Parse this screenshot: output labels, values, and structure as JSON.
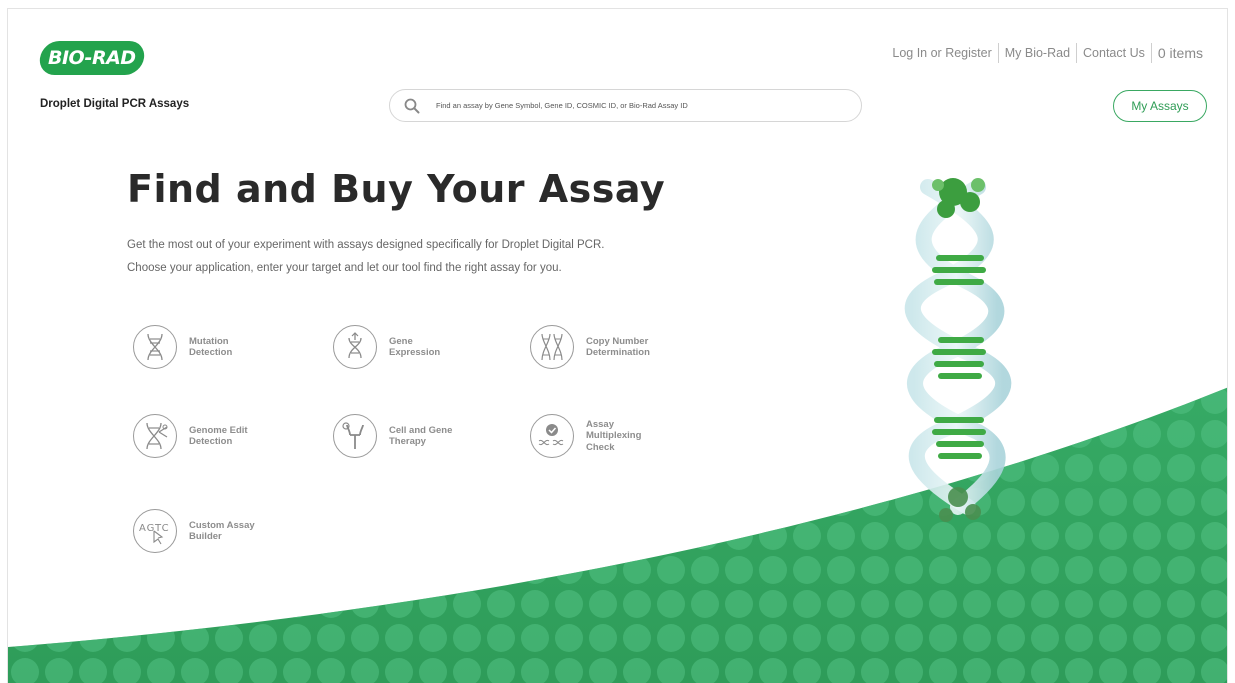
{
  "brand": {
    "logo_text": "BIO-RAD",
    "accent": "#23a34d"
  },
  "top_nav": {
    "login": "Log In or Register",
    "my_biorad": "My Bio-Rad",
    "contact": "Contact Us",
    "cart": "0 items"
  },
  "header": {
    "subtitle": "Droplet Digital PCR Assays",
    "search_placeholder": "Find an assay by Gene Symbol, Gene ID, COSMIC ID, or Bio-Rad Assay ID",
    "my_assays": "My Assays"
  },
  "hero": {
    "title": "Find and Buy Your Assay",
    "line1": "Get the most out of your experiment with assays designed specifically for Droplet Digital PCR.",
    "line2": "Choose your application, enter your target and let our tool find the right assay for you."
  },
  "applications": [
    {
      "label": "Mutation\nDetection",
      "icon": "dna-mutation-icon"
    },
    {
      "label": "Gene\nExpression",
      "icon": "gene-expression-icon"
    },
    {
      "label": "Copy Number\nDetermination",
      "icon": "copy-number-icon"
    },
    {
      "label": "Genome Edit\nDetection",
      "icon": "genome-edit-icon"
    },
    {
      "label": "Cell and Gene\nTherapy",
      "icon": "cell-gene-therapy-icon"
    },
    {
      "label": "Assay\nMultiplexing\nCheck",
      "icon": "multiplexing-check-icon"
    },
    {
      "label": "Custom Assay\nBuilder",
      "icon": "custom-assay-builder-icon"
    }
  ],
  "colors": {
    "wave_green": "#3eb570",
    "wave_dark": "#2fa25e",
    "outline_green": "#3aa862"
  }
}
